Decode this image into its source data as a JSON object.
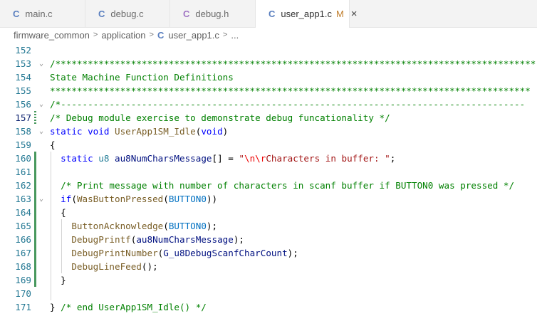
{
  "tabs": [
    {
      "icon": "C",
      "label": "main.c",
      "color": "#5a7fbf"
    },
    {
      "icon": "C",
      "label": "debug.c",
      "color": "#5a7fbf"
    },
    {
      "icon": "C",
      "label": "debug.h",
      "color": "#a074c4"
    },
    {
      "icon": "C",
      "label": "user_app1.c",
      "color": "#5a7fbf",
      "modified": "M",
      "close": "×",
      "active": true
    }
  ],
  "breadcrumb": [
    "firmware_common",
    "application",
    "user_app1.c",
    "..."
  ],
  "breadcrumb_sep": ">",
  "breadcrumb_icon": "C",
  "current_line": "157",
  "lines": [
    {
      "n": "152",
      "tokens": []
    },
    {
      "n": "153",
      "fold": "⌄",
      "tokens": [
        {
          "t": "/*****************************************************************************************",
          "c": "comment"
        }
      ]
    },
    {
      "n": "154",
      "tokens": [
        {
          "t": "State Machine Function Definitions",
          "c": "comment"
        }
      ]
    },
    {
      "n": "155",
      "tokens": [
        {
          "t": "*****************************************************************************************",
          "c": "comment"
        }
      ]
    },
    {
      "n": "156",
      "fold": "⌄",
      "tokens": [
        {
          "t": "/*--------------------------------------------------------------------------------------",
          "c": "comment"
        }
      ]
    },
    {
      "n": "157",
      "tokens": [
        {
          "t": "/* Debug module exercise to demonstrate debug funcationality */",
          "c": "comment"
        }
      ]
    },
    {
      "n": "158",
      "fold": "⌄",
      "tokens": [
        {
          "t": "static ",
          "c": "keyword"
        },
        {
          "t": "void ",
          "c": "keyword"
        },
        {
          "t": "UserApp1SM_Idle",
          "c": "func"
        },
        {
          "t": "(",
          "c": "punct"
        },
        {
          "t": "void",
          "c": "keyword"
        },
        {
          "t": ")",
          "c": "punct"
        }
      ]
    },
    {
      "n": "159",
      "tokens": [
        {
          "t": "{",
          "c": "punct"
        }
      ]
    },
    {
      "n": "160",
      "tokens": [
        {
          "t": "  static ",
          "c": "keyword"
        },
        {
          "t": "u8 ",
          "c": "type"
        },
        {
          "t": "au8NumCharsMessage",
          "c": "var"
        },
        {
          "t": "[] = ",
          "c": "punct"
        },
        {
          "t": "\"",
          "c": "string"
        },
        {
          "t": "\\n\\r",
          "c": "escape"
        },
        {
          "t": "Characters in buffer: \"",
          "c": "string"
        },
        {
          "t": ";",
          "c": "punct"
        }
      ]
    },
    {
      "n": "161",
      "tokens": []
    },
    {
      "n": "162",
      "tokens": [
        {
          "t": "  /* Print message with number of characters in scanf buffer if BUTTON0 was pressed */",
          "c": "comment"
        }
      ]
    },
    {
      "n": "163",
      "fold": "⌄",
      "tokens": [
        {
          "t": "  if",
          "c": "keyword"
        },
        {
          "t": "(",
          "c": "punct"
        },
        {
          "t": "WasButtonPressed",
          "c": "func"
        },
        {
          "t": "(",
          "c": "punct"
        },
        {
          "t": "BUTTON0",
          "c": "const"
        },
        {
          "t": "))",
          "c": "punct"
        }
      ]
    },
    {
      "n": "164",
      "tokens": [
        {
          "t": "  {",
          "c": "punct"
        }
      ]
    },
    {
      "n": "165",
      "tokens": [
        {
          "t": "    ",
          "c": "punct"
        },
        {
          "t": "ButtonAcknowledge",
          "c": "func"
        },
        {
          "t": "(",
          "c": "punct"
        },
        {
          "t": "BUTTON0",
          "c": "const"
        },
        {
          "t": ");",
          "c": "punct"
        }
      ]
    },
    {
      "n": "166",
      "tokens": [
        {
          "t": "    ",
          "c": "punct"
        },
        {
          "t": "DebugPrintf",
          "c": "func"
        },
        {
          "t": "(",
          "c": "punct"
        },
        {
          "t": "au8NumCharsMessage",
          "c": "var"
        },
        {
          "t": ");",
          "c": "punct"
        }
      ]
    },
    {
      "n": "167",
      "tokens": [
        {
          "t": "    ",
          "c": "punct"
        },
        {
          "t": "DebugPrintNumber",
          "c": "func"
        },
        {
          "t": "(",
          "c": "punct"
        },
        {
          "t": "G_u8DebugScanfCharCount",
          "c": "var"
        },
        {
          "t": ");",
          "c": "punct"
        }
      ]
    },
    {
      "n": "168",
      "tokens": [
        {
          "t": "    ",
          "c": "punct"
        },
        {
          "t": "DebugLineFeed",
          "c": "func"
        },
        {
          "t": "();",
          "c": "punct"
        }
      ]
    },
    {
      "n": "169",
      "tokens": [
        {
          "t": "  }",
          "c": "punct"
        }
      ]
    },
    {
      "n": "170",
      "tokens": []
    },
    {
      "n": "171",
      "tokens": [
        {
          "t": "} ",
          "c": "punct"
        },
        {
          "t": "/* end UserApp1SM_Idle() */",
          "c": "comment"
        }
      ]
    }
  ],
  "modified_lines": [
    "157",
    "160",
    "161",
    "162",
    "163",
    "164",
    "165",
    "166",
    "167",
    "168",
    "169"
  ],
  "colors": {
    "added": "#48985d",
    "modified": "#1f6feb"
  }
}
